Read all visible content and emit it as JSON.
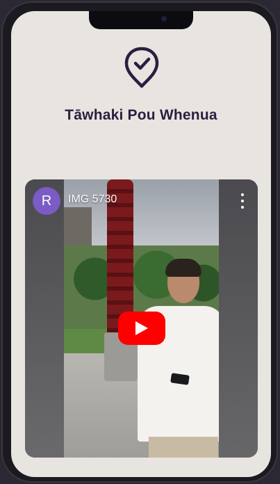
{
  "place": {
    "title": "Tāwhaki Pou Whenua"
  },
  "video": {
    "channel_initial": "R",
    "title": "IMG 5730",
    "avatar_color": "#7a5cc4",
    "play_button_color": "#ff0000"
  },
  "icons": {
    "location": "location-check-icon",
    "menu": "more-vertical-icon",
    "play": "youtube-play-icon"
  },
  "colors": {
    "screen_background": "#e8e5e1",
    "title_color": "#2a1f3f",
    "device_frame": "#1b1a20"
  }
}
